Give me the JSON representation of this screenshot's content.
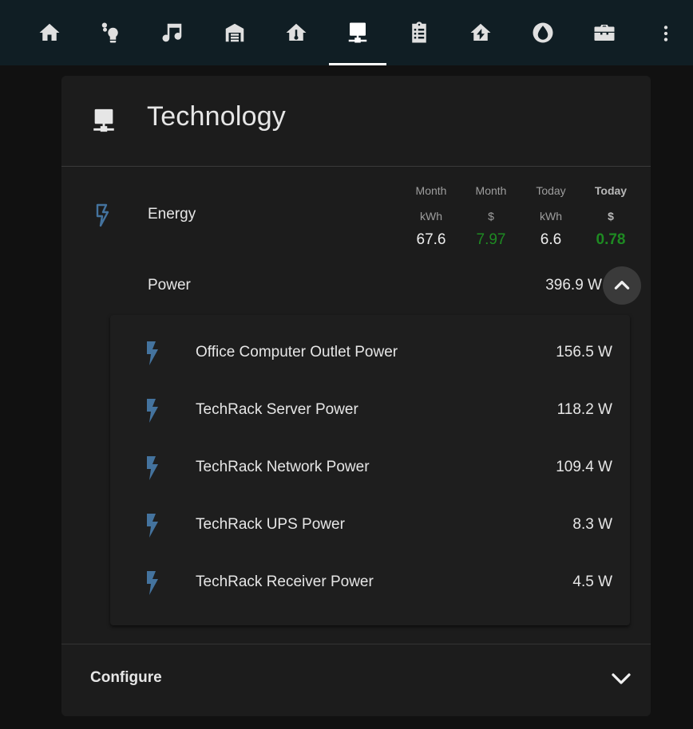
{
  "tabs": [
    {
      "icon": "home-icon"
    },
    {
      "icon": "lightbulb-icon"
    },
    {
      "icon": "music-icon"
    },
    {
      "icon": "garage-icon"
    },
    {
      "icon": "home-thermometer-icon"
    },
    {
      "icon": "desktop-network-icon",
      "active": true
    },
    {
      "icon": "clipboard-list-icon"
    },
    {
      "icon": "home-lightning-icon"
    },
    {
      "icon": "water-icon"
    },
    {
      "icon": "toolbox-icon"
    }
  ],
  "card": {
    "title": "Technology",
    "icon": "desktop-network-icon"
  },
  "energy": {
    "label": "Energy",
    "columns": [
      {
        "header1": "Month",
        "header2": "kWh",
        "value": "67.6"
      },
      {
        "header1": "Month",
        "header2": "$",
        "value": "7.97"
      },
      {
        "header1": "Today",
        "header2": "kWh",
        "value": "6.6"
      },
      {
        "header1": "Today",
        "header2": "$",
        "value": "0.78"
      }
    ]
  },
  "power": {
    "label": "Power",
    "value": "396.9 W"
  },
  "entities": [
    {
      "name": "Office Computer Outlet Power",
      "value": "156.5 W"
    },
    {
      "name": "TechRack Server Power",
      "value": "118.2 W"
    },
    {
      "name": "TechRack Network Power",
      "value": "109.4 W"
    },
    {
      "name": "TechRack UPS Power",
      "value": "8.3 W"
    },
    {
      "name": "TechRack Receiver Power",
      "value": "4.5 W"
    }
  ],
  "configure": {
    "label": "Configure"
  },
  "colors": {
    "accent_blue": "#44739e",
    "money_green": "#1e8a22",
    "topbar": "#101e24"
  }
}
